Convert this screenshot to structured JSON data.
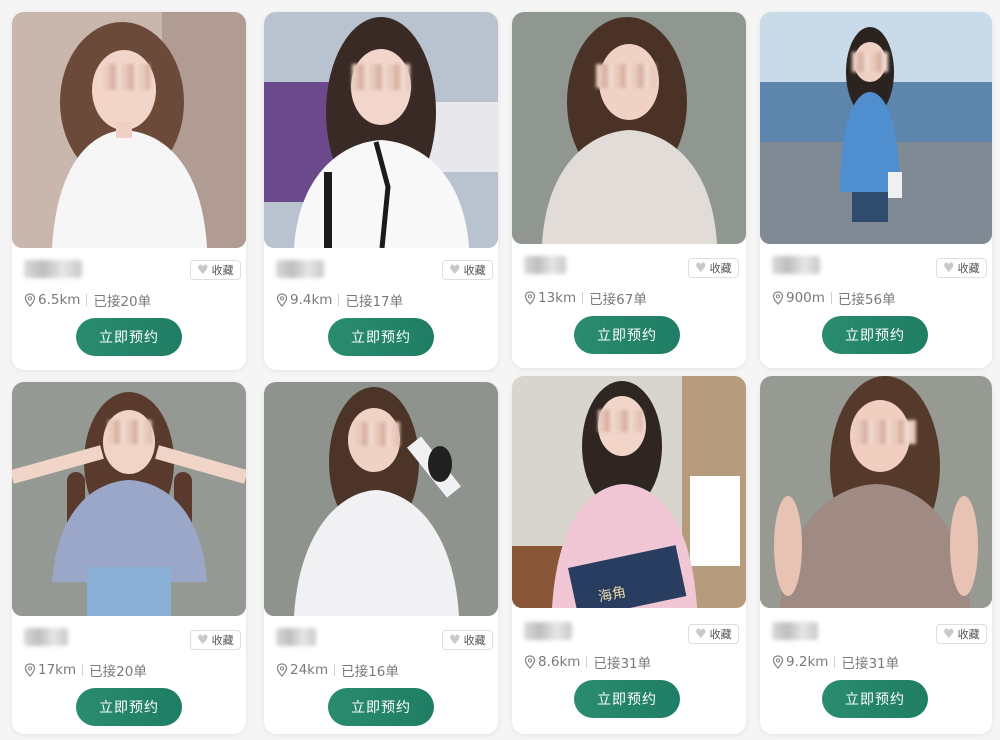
{
  "cards": [
    {
      "distance": "6.5km",
      "orders": "已接20单",
      "fav_label": "收藏",
      "book_label": "立即预约",
      "colors": {
        "bg": "#c9b7ae",
        "hair": "#6b4a3a",
        "top": "#f6f6f6"
      }
    },
    {
      "distance": "9.4km",
      "orders": "已接17单",
      "fav_label": "收藏",
      "book_label": "立即预约",
      "colors": {
        "bg": "#b9c3cf",
        "hair": "#3a2a25",
        "top": "#f8f8f8"
      }
    },
    {
      "distance": "13km",
      "orders": "已接67单",
      "fav_label": "收藏",
      "book_label": "立即预约",
      "colors": {
        "bg": "#8f9790",
        "hair": "#4a3326",
        "top": "#e2dcd8"
      }
    },
    {
      "distance": "900m",
      "orders": "已接56单",
      "fav_label": "收藏",
      "book_label": "立即预约",
      "colors": {
        "bg": "#8db4d4",
        "hair": "#2b2320",
        "top": "#4f8fd0"
      }
    },
    {
      "distance": "17km",
      "orders": "已接20单",
      "fav_label": "收藏",
      "book_label": "立即预约",
      "colors": {
        "bg": "#949a93",
        "hair": "#5a3a2c",
        "top": "#9aa7c8"
      }
    },
    {
      "distance": "24km",
      "orders": "已接16单",
      "fav_label": "收藏",
      "book_label": "立即预约",
      "colors": {
        "bg": "#8e948d",
        "hair": "#4c3528",
        "top": "#f1f1f3"
      }
    },
    {
      "distance": "8.6km",
      "orders": "已接31单",
      "fav_label": "收藏",
      "book_label": "立即预约",
      "colors": {
        "bg": "#d8d4ce",
        "hair": "#2f2622",
        "top": "#f1c7d6"
      }
    },
    {
      "distance": "9.2km",
      "orders": "已接31单",
      "fav_label": "收藏",
      "book_label": "立即预约",
      "colors": {
        "bg": "#969a92",
        "hair": "#553a2c",
        "top": "#a08a84"
      }
    }
  ],
  "book_cover_text": "海角"
}
